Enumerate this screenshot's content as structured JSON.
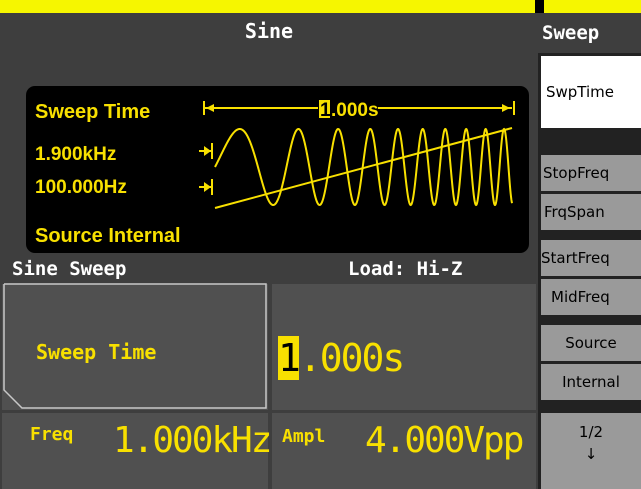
{
  "screen": {
    "title": "Sine",
    "display": {
      "sweep_time_label": "Sweep Time",
      "sweep_time_value": "1.000s",
      "stop_frequency": "1.900kHz",
      "start_frequency": "100.000Hz",
      "source": "Source Internal"
    },
    "section": {
      "title": "Sine Sweep",
      "load": "Load: Hi-Z"
    },
    "parameter": {
      "label": "Sweep Time",
      "cursor_digit": "1",
      "value_rest": ".000s"
    },
    "freq": {
      "label": "Freq",
      "value": "1.000kHz"
    },
    "ampl": {
      "label": "Ampl",
      "value": "4.000Vpp"
    }
  },
  "menu": {
    "title": "Sweep",
    "items": {
      "swptime": "SwpTime",
      "stopfreq": "StopFreq",
      "frqspan": "FrqSpan",
      "startfreq": "StartFreq",
      "midfreq": "MidFreq",
      "source": "Source",
      "internal": "Internal",
      "page": "1/2",
      "page_arrow": "↓"
    }
  },
  "colors": {
    "accent": "#f8e000",
    "panel": "#3e3e3e",
    "field": "#505050",
    "softkey": "#9a9a9a"
  }
}
